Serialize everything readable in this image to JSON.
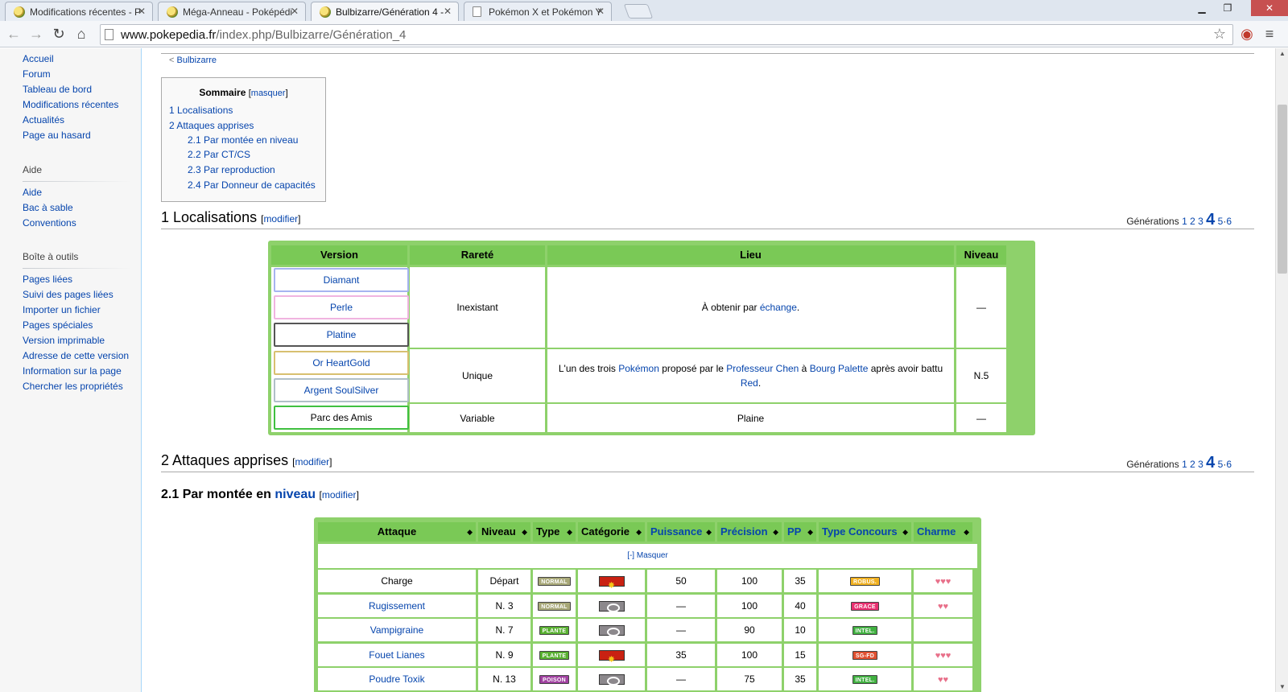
{
  "browser": {
    "tabs": [
      {
        "title": "Modifications récentes - P"
      },
      {
        "title": "Méga-Anneau - Poképédi"
      },
      {
        "title": "Bulbizarre/Génération 4 - "
      },
      {
        "title": "Pokémon X et Pokémon Y"
      }
    ],
    "url_host": "www.pokepedia.fr",
    "url_path": "/index.php/Bulbizarre/Génération_4"
  },
  "sidebar": {
    "nav": [
      "Accueil",
      "Forum",
      "Tableau de bord",
      "Modifications récentes",
      "Actualités",
      "Page au hasard"
    ],
    "aide_title": "Aide",
    "aide": [
      "Aide",
      "Bac à sable",
      "Conventions"
    ],
    "tools_title": "Boîte à outils",
    "tools": [
      "Pages liées",
      "Suivi des pages liées",
      "Importer un fichier",
      "Pages spéciales",
      "Version imprimable",
      "Adresse de cette version",
      "Information sur la page",
      "Chercher les propriétés"
    ]
  },
  "page": {
    "backlink_arrow": "<",
    "backlink": "Bulbizarre",
    "toc": {
      "title": "Sommaire",
      "toggle": "masquer",
      "items": [
        "1 Localisations",
        "2 Attaques apprises",
        "2.1 Par montée en niveau",
        "2.2 Par CT/CS",
        "2.3 Par reproduction",
        "2.4 Par Donneur de capacités"
      ]
    },
    "edit_label": "modifier",
    "generations": {
      "label": "Générations",
      "g1": "1",
      "g2": "2",
      "g3": "3",
      "current": "4",
      "g5": "5",
      "sep": "·",
      "g6": "6"
    },
    "h_localisations": "1 Localisations",
    "h_attaques": "2 Attaques apprises",
    "h_niveau_prefix": "2.1 Par montée en ",
    "h_niveau_link": "niveau"
  },
  "localisations": {
    "headers": [
      "Version",
      "Rareté",
      "Lieu",
      "Niveau"
    ],
    "versions": [
      "Diamant",
      "Perle",
      "Platine",
      "Or HeartGold",
      "Argent SoulSilver",
      "Parc des Amis"
    ],
    "version_colors": [
      "#a6b4f0",
      "#f0b4e0",
      "#555555",
      "#d8c070",
      "#b0c0c8",
      "#40c040"
    ],
    "group1": {
      "rarete": "Inexistant",
      "lieu_prefix": "À obtenir par ",
      "lieu_link": "échange",
      "lieu_suffix": ".",
      "niveau": "—"
    },
    "group2": {
      "rarete": "Unique",
      "t1": "L'un des trois ",
      "l1": "Pokémon",
      "t2": " proposé par le ",
      "l2": "Professeur Chen",
      "t3": " à ",
      "l3": "Bourg Palette",
      "t4": " après avoir battu ",
      "l4": "Red",
      "t5": ".",
      "niveau": "N.5"
    },
    "group3": {
      "rarete": "Variable",
      "lieu": "Plaine",
      "niveau": "—"
    }
  },
  "moves": {
    "headers": [
      "Attaque",
      "Niveau",
      "Type",
      "Catégorie",
      "Puissance",
      "Précision",
      "PP",
      "Type Concours",
      "Charme"
    ],
    "sort_icon": "◆",
    "masquer": "[-] Masquer",
    "rows": [
      {
        "attaque": "Charge",
        "niveau": "Départ",
        "type": "NORMAL",
        "type_color": "#a8a878",
        "cat": "phys",
        "puissance": "50",
        "precision": "100",
        "pp": "35",
        "concours": "ROBUS.",
        "concours_color": "#f0b020",
        "charme": "♥♥♥"
      },
      {
        "attaque": "Rugissement",
        "niveau": "N. 3",
        "type": "NORMAL",
        "type_color": "#a8a878",
        "cat": "stat",
        "puissance": "—",
        "precision": "100",
        "pp": "40",
        "concours": "GRACE",
        "concours_color": "#e83070",
        "charme": "♥♥"
      },
      {
        "attaque": "Vampigraine",
        "niveau": "N. 7",
        "type": "PLANTE",
        "type_color": "#58b030",
        "cat": "stat",
        "puissance": "—",
        "precision": "90",
        "pp": "10",
        "concours": "INTEL.",
        "concours_color": "#40b040",
        "charme": ""
      },
      {
        "attaque": "Fouet Lianes",
        "niveau": "N. 9",
        "type": "PLANTE",
        "type_color": "#58b030",
        "cat": "phys",
        "puissance": "35",
        "precision": "100",
        "pp": "15",
        "concours": "SG-FD",
        "concours_color": "#e05030",
        "charme": "♥♥♥"
      },
      {
        "attaque": "Poudre Toxik",
        "niveau": "N. 13",
        "type": "POISON",
        "type_color": "#a040a0",
        "cat": "stat",
        "puissance": "—",
        "precision": "75",
        "pp": "35",
        "concours": "INTEL.",
        "concours_color": "#40b040",
        "charme": "♥♥"
      }
    ]
  }
}
